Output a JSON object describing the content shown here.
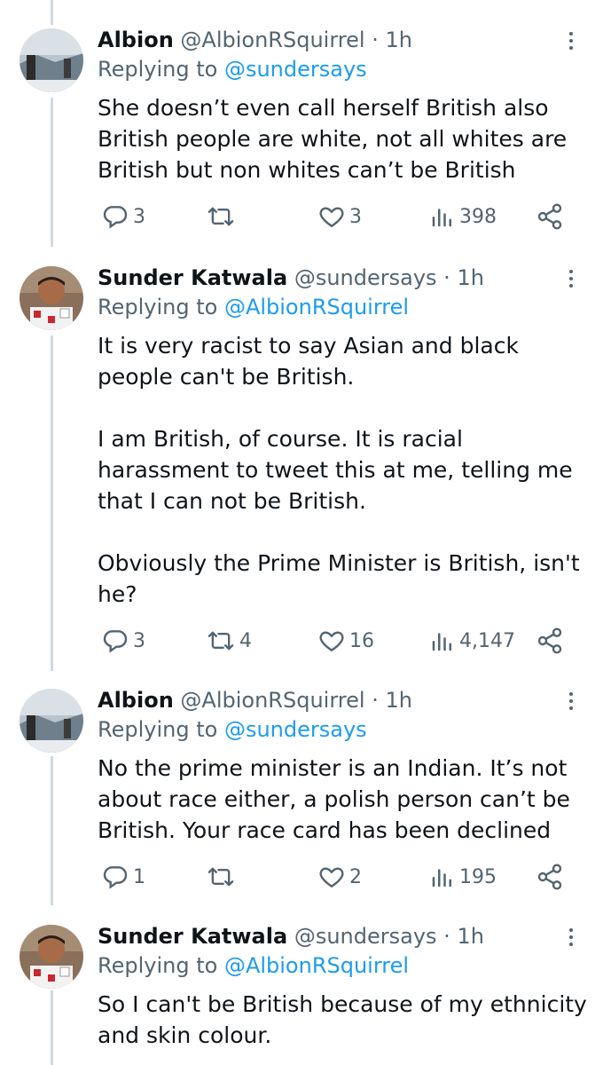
{
  "tweets": [
    {
      "name": "Albion",
      "handle": "@AlbionRSquirrel",
      "separator": "·",
      "time": "1h",
      "replying_prefix": "Replying to ",
      "replying_to": "@sundersays",
      "text": "She doesn’t even call herself British also British people are white, not all whites are British but non whites can’t be British",
      "replies": "3",
      "retweets": "",
      "likes": "3",
      "views": "398",
      "avatar_icon": "landscape-avatar"
    },
    {
      "name": "Sunder Katwala",
      "handle": "@sundersays",
      "separator": "·",
      "time": "1h",
      "replying_prefix": "Replying to ",
      "replying_to": "@AlbionRSquirrel",
      "text": "It is very racist to say Asian and black people can't be British.\n\n I am British, of course. It is racial harassment to tweet this at me, telling me that I can not be British.\n\nObviously the Prime Minister is British, isn't he?",
      "replies": "3",
      "retweets": "4",
      "likes": "16",
      "views": "4,147",
      "avatar_icon": "person-avatar"
    },
    {
      "name": "Albion",
      "handle": "@AlbionRSquirrel",
      "separator": "·",
      "time": "1h",
      "replying_prefix": "Replying to ",
      "replying_to": "@sundersays",
      "text": "No the prime minister is an Indian. It’s not about race either, a polish person can’t be British. Your race card has been declined",
      "replies": "1",
      "retweets": "",
      "likes": "2",
      "views": "195",
      "avatar_icon": "landscape-avatar"
    },
    {
      "name": "Sunder Katwala",
      "handle": "@sundersays",
      "separator": "·",
      "time": "1h",
      "replying_prefix": "Replying to ",
      "replying_to": "@AlbionRSquirrel",
      "text": "So I can't be British because of my ethnicity and skin colour.",
      "avatar_icon": "person-avatar"
    }
  ],
  "icons": {
    "reply": "reply-icon",
    "retweet": "retweet-icon",
    "like": "heart-icon",
    "views": "views-icon",
    "share": "share-icon",
    "more": "more-icon"
  },
  "colors": {
    "text": "#0f1419",
    "secondary": "#536471",
    "link": "#1d9bf0",
    "thread_line": "#cfd9de"
  }
}
